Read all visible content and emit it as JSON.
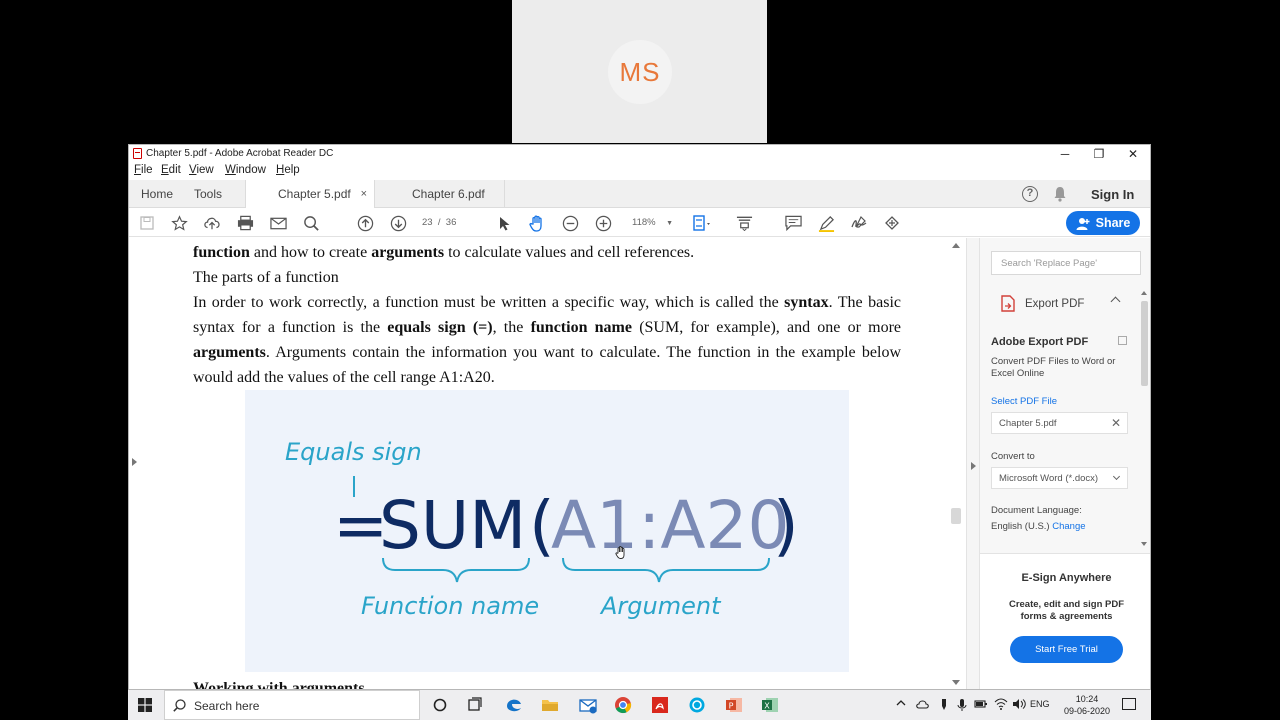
{
  "meeting": {
    "participant_initials": "MS"
  },
  "window": {
    "title": "Chapter 5.pdf - Adobe Acrobat Reader DC",
    "controls": {
      "minimize": "─",
      "restore": "❐",
      "close": "✕"
    }
  },
  "menu": [
    "File",
    "Edit",
    "View",
    "Window",
    "Help"
  ],
  "tabs": {
    "home": "Home",
    "tools": "Tools",
    "active_doc": "Chapter 5.pdf",
    "other_doc": "Chapter 6.pdf",
    "close_glyph": "×"
  },
  "account": {
    "sign_in": "Sign In",
    "help_glyph": "?"
  },
  "toolbar": {
    "current_page": "23",
    "page_sep": "/",
    "total_pages": "36",
    "zoom": "118%",
    "share_label": "Share"
  },
  "document": {
    "line1_b1": "function",
    "line1_t1": " and how to create ",
    "line1_b2": "arguments",
    "line1_t2": " to calculate values and cell references.",
    "heading": "The parts of a function",
    "para_t1": "In order to work correctly, a function must be written a specific way, which is called the ",
    "para_b1": "syntax",
    "para_t2": ". The basic syntax for a function is the ",
    "para_b2": "equals sign (=)",
    "para_t3": ", the ",
    "para_b3": "function name",
    "para_t4": " (SUM, for example), and one or more ",
    "para_b4": "arguments",
    "para_t5": ". Arguments contain the information you want to calculate. The function in the example below would add the values of the cell range A1:A20.",
    "next_heading": "Working with arguments"
  },
  "figure": {
    "equals_label": "Equals sign",
    "equals": "=",
    "function_name": "SUM",
    "open_paren": "(",
    "argument": "A1:A20",
    "close_paren": ")",
    "function_label": "Function name",
    "argument_label": "Argument",
    "colors": {
      "label": "#2aa4c9",
      "function": "#0e2b63",
      "argument": "#7b8ab5",
      "background": "#eef3fb"
    }
  },
  "right_pane": {
    "search_placeholder": "Search 'Replace Page'",
    "export_title": "Export PDF",
    "adobe_export": "Adobe Export PDF",
    "convert_desc": "Convert PDF Files to Word or Excel Online",
    "select_file": "Select PDF File",
    "file_name": "Chapter 5.pdf",
    "convert_to": "Convert to",
    "format": "Microsoft Word (*.docx)",
    "doc_lang_label": "Document Language:",
    "doc_lang_value": "English (U.S.)",
    "change": "Change",
    "esign_title": "E-Sign Anywhere",
    "esign_desc": "Create, edit and sign PDF forms & agreements",
    "trial_button": "Start Free Trial"
  },
  "taskbar": {
    "search_placeholder": "Search here",
    "language": "ENG",
    "time": "10:24",
    "date": "09-06-2020"
  }
}
